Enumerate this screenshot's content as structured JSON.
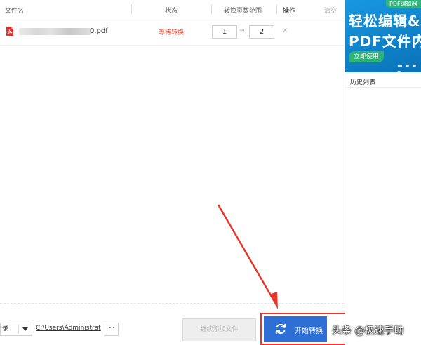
{
  "table_header": {
    "filename": "文件名",
    "status": "状态",
    "page_range": "转换页数范围",
    "action": "操作",
    "clear": "清空"
  },
  "files": [
    {
      "name_suffix": "0.pdf",
      "status": "等待转换",
      "page_from": "1",
      "page_to": "2",
      "page_separator": "→",
      "delete": "×"
    }
  ],
  "bottom": {
    "output_dir_value": "录",
    "output_path": "C:\\Users\\Administrat",
    "more_label": "···",
    "add_files_label": "继续添加文件",
    "start_label": "开始转换"
  },
  "sidebar": {
    "ad": {
      "tag": "PDF编辑器",
      "line1": "轻松编辑&修",
      "line2": "PDF文件内",
      "cta": "立即使用",
      "dots": "▬ ▪ ▪ ▪"
    },
    "history_label": "历史列表"
  },
  "watermark": "头条 @极速手助",
  "colors": {
    "primary_button": "#2d6fd4",
    "status_waiting": "#e84d3c",
    "highlight_box": "#e8352b",
    "ad_background": "#0b7fc4",
    "ad_accent": "#2db37a"
  }
}
